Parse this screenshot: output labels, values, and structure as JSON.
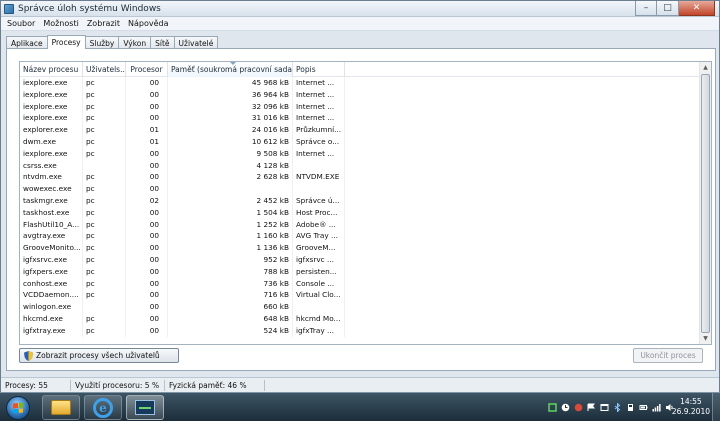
{
  "window": {
    "title": "Správce úloh systému Windows",
    "controls": {
      "minimize": "–",
      "maximize": "□",
      "close": "✕"
    }
  },
  "menu": [
    "Soubor",
    "Možnosti",
    "Zobrazit",
    "Nápověda"
  ],
  "tabs": [
    "Aplikace",
    "Procesy",
    "Služby",
    "Výkon",
    "Sítě",
    "Uživatelé"
  ],
  "active_tab": "Procesy",
  "columns": {
    "name": "Název procesu",
    "user": "Uživatels...",
    "cpu": "Procesor",
    "memory": "Paměť (soukromá pracovní sada)",
    "description": "Popis"
  },
  "processes": [
    {
      "name": "iexplore.exe",
      "user": "pc",
      "cpu": "00",
      "memory": "45 968 kB",
      "description": "Internet ..."
    },
    {
      "name": "iexplore.exe",
      "user": "pc",
      "cpu": "00",
      "memory": "36 964 kB",
      "description": "Internet ..."
    },
    {
      "name": "iexplore.exe",
      "user": "pc",
      "cpu": "00",
      "memory": "32 096 kB",
      "description": "Internet ..."
    },
    {
      "name": "iexplore.exe",
      "user": "pc",
      "cpu": "00",
      "memory": "31 016 kB",
      "description": "Internet ..."
    },
    {
      "name": "explorer.exe",
      "user": "pc",
      "cpu": "01",
      "memory": "24 016 kB",
      "description": "Průzkumní..."
    },
    {
      "name": "dwm.exe",
      "user": "pc",
      "cpu": "01",
      "memory": "10 612 kB",
      "description": "Správce o..."
    },
    {
      "name": "iexplore.exe",
      "user": "pc",
      "cpu": "00",
      "memory": "9 508 kB",
      "description": "Internet ..."
    },
    {
      "name": "csrss.exe",
      "user": "",
      "cpu": "00",
      "memory": "4 128 kB",
      "description": ""
    },
    {
      "name": "ntvdm.exe",
      "user": "pc",
      "cpu": "00",
      "memory": "2 628 kB",
      "description": "NTVDM.EXE"
    },
    {
      "name": "  wowexec.exe",
      "user": "pc",
      "cpu": "00",
      "memory": "",
      "description": ""
    },
    {
      "name": "taskmgr.exe",
      "user": "pc",
      "cpu": "02",
      "memory": "2 452 kB",
      "description": "Správce ú..."
    },
    {
      "name": "taskhost.exe",
      "user": "pc",
      "cpu": "00",
      "memory": "1 504 kB",
      "description": "Host Proc..."
    },
    {
      "name": "FlashUtil10_A...",
      "user": "pc",
      "cpu": "00",
      "memory": "1 252 kB",
      "description": "Adobe® ..."
    },
    {
      "name": "avgtray.exe",
      "user": "pc",
      "cpu": "00",
      "memory": "1 160 kB",
      "description": "AVG Tray ..."
    },
    {
      "name": "GrooveMonito...",
      "user": "pc",
      "cpu": "00",
      "memory": "1 136 kB",
      "description": "GrooveM..."
    },
    {
      "name": "igfxsrvc.exe",
      "user": "pc",
      "cpu": "00",
      "memory": "952 kB",
      "description": "igfxsrvc ..."
    },
    {
      "name": "igfxpers.exe",
      "user": "pc",
      "cpu": "00",
      "memory": "788 kB",
      "description": "persisten..."
    },
    {
      "name": "conhost.exe",
      "user": "pc",
      "cpu": "00",
      "memory": "736 kB",
      "description": "Console ..."
    },
    {
      "name": "VCDDaemon....",
      "user": "pc",
      "cpu": "00",
      "memory": "716 kB",
      "description": "Virtual Clo..."
    },
    {
      "name": "winlogon.exe",
      "user": "",
      "cpu": "00",
      "memory": "660 kB",
      "description": ""
    },
    {
      "name": "hkcmd.exe",
      "user": "pc",
      "cpu": "00",
      "memory": "648 kB",
      "description": "hkcmd Mo..."
    },
    {
      "name": "igfxtray.exe",
      "user": "pc",
      "cpu": "00",
      "memory": "524 kB",
      "description": "igfxTray ..."
    }
  ],
  "buttons": {
    "show_all": "Zobrazit procesy všech uživatelů",
    "end_process": "Ukončit proces"
  },
  "status": {
    "processes": "Procesy: 55",
    "cpu": "Využití procesoru: 5 %",
    "memory": "Fyzická paměť: 46 %"
  },
  "taskbar": {
    "tray_icons": [
      "green-square-icon",
      "clock-icon",
      "tray-app-icon",
      "flag-icon",
      "window-icon",
      "bluetooth-icon",
      "usb-icon",
      "battery-icon",
      "signal-icon",
      "volume-icon"
    ],
    "time": "14:55",
    "date": "26.9.2010"
  },
  "colors": {
    "title_bg": "#dfe6ee",
    "taskbar_bg": "#1c2d3a",
    "close_button": "#c1452a",
    "sorted_column": "#eef6fd"
  }
}
